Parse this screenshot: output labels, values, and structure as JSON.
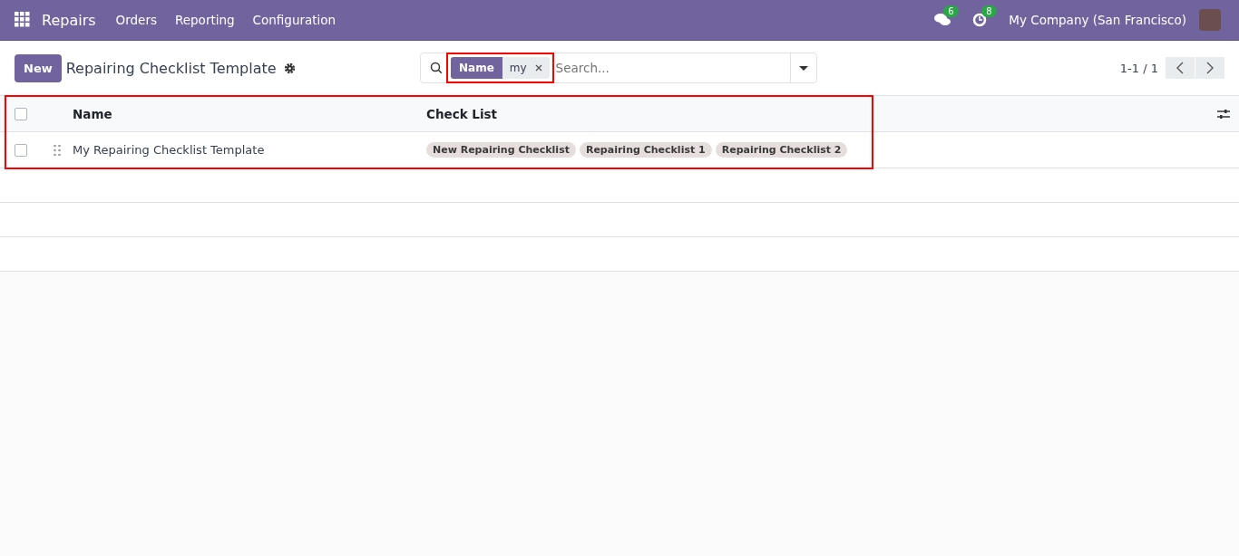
{
  "navbar": {
    "app_name": "Repairs",
    "menu": [
      "Orders",
      "Reporting",
      "Configuration"
    ],
    "messages_count": "6",
    "activities_count": "8",
    "company": "My Company (San Francisco)"
  },
  "control_panel": {
    "new_button": "New",
    "title": "Repairing Checklist Template",
    "facet": {
      "label": "Name",
      "value": "my"
    },
    "search": {
      "placeholder": "Search..."
    },
    "pager": "1-1 / 1"
  },
  "table": {
    "columns": [
      "Name",
      "Check List"
    ],
    "select_all_checked": false,
    "rows": [
      {
        "checked": false,
        "name": "My Repairing Checklist Template",
        "tags": [
          "New Repairing Checklist",
          "Repairing Checklist 1",
          "Repairing Checklist 2"
        ]
      }
    ]
  }
}
